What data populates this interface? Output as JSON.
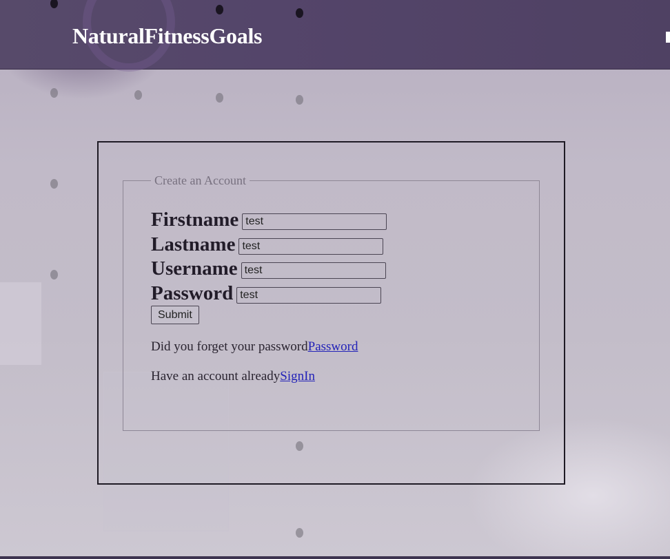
{
  "header": {
    "brand": "NaturalFitnessGoals"
  },
  "form": {
    "legend": "Create an Account",
    "fields": [
      {
        "label": "Firstname",
        "value": "test"
      },
      {
        "label": "Lastname",
        "value": "test"
      },
      {
        "label": "Username",
        "value": "test"
      },
      {
        "label": "Password",
        "value": "test"
      }
    ],
    "submit_label": "Submit",
    "forgot_text": "Did you forget your password",
    "forgot_link": "Password",
    "signin_text": "Have an account already",
    "signin_link": "SignIn"
  },
  "colors": {
    "header_bg": "#54456a",
    "link": "#2323b8"
  }
}
